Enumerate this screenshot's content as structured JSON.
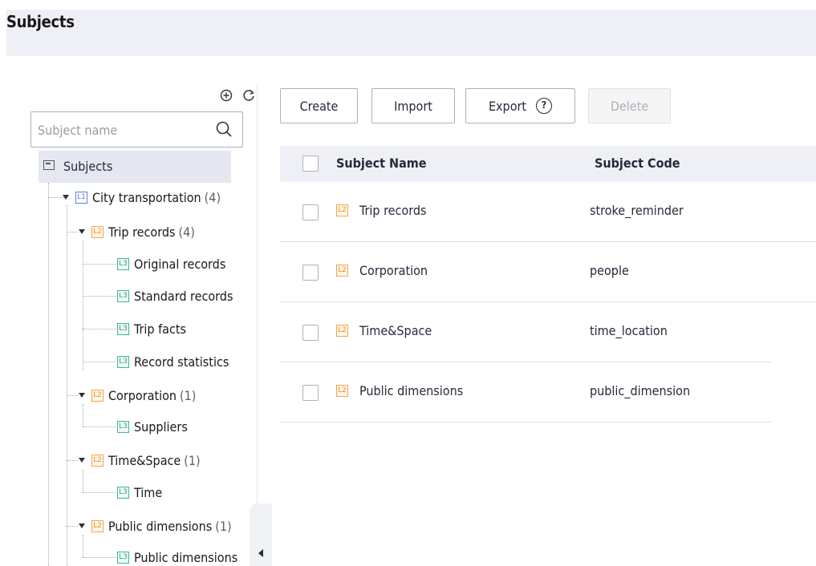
{
  "page": {
    "title": "Subjects"
  },
  "tree": {
    "search_placeholder": "Subject name",
    "root_label": "Subjects",
    "nodes": [
      {
        "level": "L1",
        "label": "City transportation",
        "count": "(4)"
      },
      {
        "level": "L2",
        "label": "Trip records",
        "count": "(4)"
      },
      {
        "level": "L3",
        "label": "Original records"
      },
      {
        "level": "L3",
        "label": "Standard records"
      },
      {
        "level": "L3",
        "label": "Trip facts"
      },
      {
        "level": "L3",
        "label": "Record statistics"
      },
      {
        "level": "L2",
        "label": "Corporation",
        "count": "(1)"
      },
      {
        "level": "L3",
        "label": "Suppliers"
      },
      {
        "level": "L2",
        "label": "Time&Space",
        "count": "(1)"
      },
      {
        "level": "L3",
        "label": "Time"
      },
      {
        "level": "L2",
        "label": "Public dimensions",
        "count": "(1)"
      },
      {
        "level": "L3",
        "label": "Public dimensions"
      }
    ]
  },
  "toolbar": {
    "create_label": "Create",
    "import_label": "Import",
    "export_label": "Export",
    "delete_label": "Delete"
  },
  "table": {
    "columns": [
      "Subject Name",
      "Subject Code"
    ],
    "rows": [
      {
        "level": "L2",
        "name": "Trip records",
        "code": "stroke_reminder"
      },
      {
        "level": "L2",
        "name": "Corporation",
        "code": "people"
      },
      {
        "level": "L2",
        "name": "Time&Space",
        "code": "time_location"
      },
      {
        "level": "L2",
        "name": "Public dimensions",
        "code": "public_dimension"
      }
    ]
  },
  "colors": {
    "header_band": "#eef0f5",
    "l1": "#5e7ce0",
    "l2": "#f08c1a",
    "l3": "#2aa674"
  }
}
